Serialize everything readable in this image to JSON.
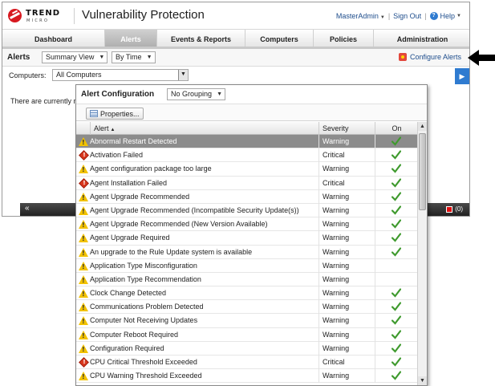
{
  "header": {
    "logo_top": "TREND",
    "logo_bottom": "MICRO",
    "title": "Vulnerability Protection",
    "user": "MasterAdmin",
    "sign_out": "Sign Out",
    "help": "Help"
  },
  "nav": {
    "tabs": [
      {
        "label": "Dashboard",
        "active": false
      },
      {
        "label": "Alerts",
        "active": true
      },
      {
        "label": "Events & Reports",
        "active": false
      },
      {
        "label": "Computers",
        "active": false
      },
      {
        "label": "Policies",
        "active": false
      },
      {
        "label": "Administration",
        "active": false
      }
    ]
  },
  "alerts_bar": {
    "title": "Alerts",
    "view_select": "Summary View",
    "time_select": "By Time",
    "configure_link": "Configure Alerts"
  },
  "computers": {
    "label": "Computers:",
    "value": "All Computers"
  },
  "notice": "There are currently n",
  "status": {
    "collapse": "«",
    "count": "(0)"
  },
  "popup": {
    "title": "Alert Configuration",
    "grouping": "No Grouping",
    "properties_button": "Properties...",
    "columns": {
      "alert": "Alert",
      "severity": "Severity",
      "on": "On"
    },
    "rows": [
      {
        "alert": "Abnormal Restart Detected",
        "severity": "Warning",
        "on": true,
        "selected": true
      },
      {
        "alert": "Activation Failed",
        "severity": "Critical",
        "on": true
      },
      {
        "alert": "Agent configuration package too large",
        "severity": "Warning",
        "on": true
      },
      {
        "alert": "Agent Installation Failed",
        "severity": "Critical",
        "on": true
      },
      {
        "alert": "Agent Upgrade Recommended",
        "severity": "Warning",
        "on": true
      },
      {
        "alert": "Agent Upgrade Recommended (Incompatible Security Update(s))",
        "severity": "Warning",
        "on": true
      },
      {
        "alert": "Agent Upgrade Recommended (New Version Available)",
        "severity": "Warning",
        "on": true
      },
      {
        "alert": "Agent Upgrade Required",
        "severity": "Warning",
        "on": true
      },
      {
        "alert": "An upgrade to the Rule Update system is available",
        "severity": "Warning",
        "on": true
      },
      {
        "alert": "Application Type Misconfiguration",
        "severity": "Warning",
        "on": false
      },
      {
        "alert": "Application Type Recommendation",
        "severity": "Warning",
        "on": false
      },
      {
        "alert": "Clock Change Detected",
        "severity": "Warning",
        "on": true
      },
      {
        "alert": "Communications Problem Detected",
        "severity": "Warning",
        "on": true
      },
      {
        "alert": "Computer Not Receiving Updates",
        "severity": "Warning",
        "on": true
      },
      {
        "alert": "Computer Reboot Required",
        "severity": "Warning",
        "on": true
      },
      {
        "alert": "Configuration Required",
        "severity": "Warning",
        "on": true
      },
      {
        "alert": "CPU Critical Threshold Exceeded",
        "severity": "Critical",
        "on": true
      },
      {
        "alert": "CPU Warning Threshold Exceeded",
        "severity": "Warning",
        "on": true
      }
    ]
  },
  "colors": {
    "accent": "#d71920",
    "link": "#1e4d8c",
    "check": "#3f9a2e",
    "warning": "#f2c200",
    "critical": "#d9381e"
  }
}
